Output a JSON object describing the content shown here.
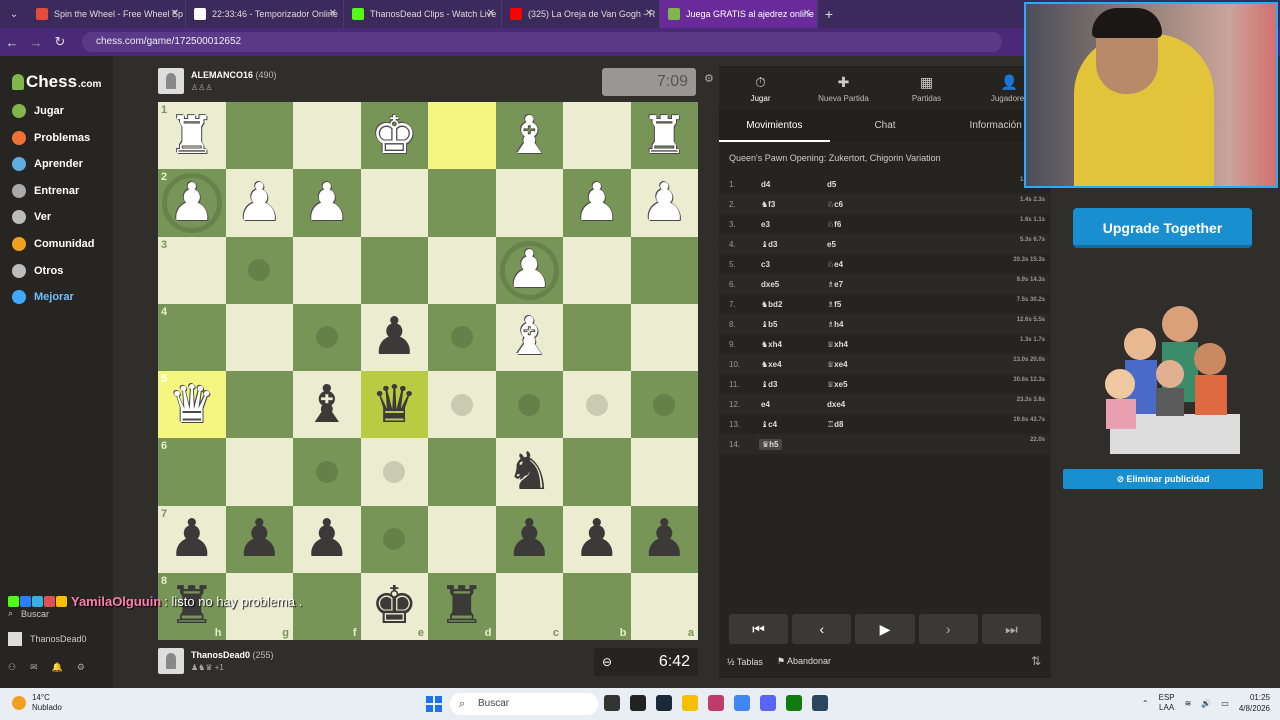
{
  "browser": {
    "tabs": [
      {
        "title": "Spin the Wheel - Free Wheel Sp",
        "color": "#e64a3b",
        "active": false
      },
      {
        "title": "22:33:46 - Temporizador Online",
        "color": "#ffffff",
        "active": false
      },
      {
        "title": "ThanosDead Clips - Watch Live",
        "color": "#53fc18",
        "active": false
      },
      {
        "title": "(325) La Oreja de Van Gogh - R",
        "color": "#ff0000",
        "active": false
      },
      {
        "title": "Juega GRATIS al ajedrez online",
        "color": "#81b64c",
        "active": true
      }
    ],
    "url": "chess.com/game/172500012652"
  },
  "sidebar": {
    "logo": "Chess",
    "logo_suffix": ".com",
    "items": [
      {
        "label": "Jugar",
        "color": "#81b64c"
      },
      {
        "label": "Problemas",
        "color": "#f27036"
      },
      {
        "label": "Aprender",
        "color": "#5dade2"
      },
      {
        "label": "Entrenar",
        "color": "#aaaaaa"
      },
      {
        "label": "Ver",
        "color": "#bbbbbb"
      },
      {
        "label": "Comunidad",
        "color": "#f0a020"
      },
      {
        "label": "Otros",
        "color": "#bbbbbb"
      },
      {
        "label": "Mejorar",
        "color": "#3fa9ff"
      }
    ],
    "search_label": "Buscar",
    "username": "ThanosDead0",
    "notification_count": "1"
  },
  "top_player": {
    "name": "ALEMANCO16",
    "rating": "(490)",
    "clock": "7:09"
  },
  "bottom_player": {
    "name": "ThanosDead0",
    "rating": "(255)",
    "clock": "6:42",
    "extra": "+1"
  },
  "board": {
    "ranks": [
      "1",
      "2",
      "3",
      "4",
      "5",
      "6",
      "7",
      "8"
    ],
    "files": [
      "h",
      "g",
      "f",
      "e",
      "d",
      "c",
      "b",
      "a"
    ],
    "squares": [
      [
        "♜",
        "",
        "",
        "♚",
        "",
        "♝",
        "",
        "♜"
      ],
      [
        "♟",
        "♟",
        "♟",
        "",
        "",
        "",
        "♟",
        "♟"
      ],
      [
        "",
        "",
        "",
        "",
        "",
        "♟",
        "",
        ""
      ],
      [
        "",
        "",
        "",
        "♟",
        "",
        "♝",
        "",
        ""
      ],
      [
        "♛",
        "",
        "♝",
        "♛",
        "",
        "",
        "",
        ""
      ],
      [
        "",
        "",
        "",
        "",
        "",
        "♞",
        "",
        ""
      ],
      [
        "♟",
        "♟",
        "♟",
        "",
        "",
        "♟",
        "♟",
        "♟"
      ],
      [
        "♜",
        "",
        "",
        "♚",
        "♜",
        "",
        "",
        ""
      ]
    ],
    "piece_colors": [
      [
        "w",
        "",
        "",
        "w",
        "",
        "w",
        "",
        "w"
      ],
      [
        "w",
        "w",
        "w",
        "",
        "",
        "",
        "w",
        "w"
      ],
      [
        "",
        "",
        "",
        "",
        "",
        "w",
        "",
        ""
      ],
      [
        "",
        "",
        "",
        "b",
        "",
        "w",
        "",
        ""
      ],
      [
        "w",
        "",
        "b",
        "b",
        "",
        "",
        "",
        ""
      ],
      [
        "",
        "",
        "",
        "",
        "",
        "b",
        "",
        ""
      ],
      [
        "b",
        "b",
        "b",
        "",
        "",
        "b",
        "b",
        "b"
      ],
      [
        "b",
        "",
        "",
        "b",
        "b",
        "",
        "",
        ""
      ]
    ],
    "highlights": [
      "0-4",
      "4-0",
      "4-3"
    ],
    "dots": [
      "2-1",
      "3-2",
      "3-4",
      "4-4",
      "4-5",
      "4-6",
      "4-7",
      "5-2",
      "5-3",
      "6-3"
    ],
    "rings": [
      "1-0",
      "2-5"
    ]
  },
  "chat_overlay": {
    "user": "YamilaOlguuin",
    "message": ": listo no hay problema ."
  },
  "panel": {
    "tabs": [
      {
        "label": "Jugar",
        "icon": "⏱"
      },
      {
        "label": "Nueva Partida",
        "icon": "✚"
      },
      {
        "label": "Partidas",
        "icon": "▦"
      },
      {
        "label": "Jugadores",
        "icon": "👤"
      }
    ],
    "subtabs": [
      "Movimientos",
      "Chat",
      "Información"
    ],
    "opening": "Queen's Pawn Opening: Zukertort, Chigorin Variation",
    "moves": [
      {
        "n": "1.",
        "w": "d4",
        "b": "d5",
        "t": "1.3s 1.3s"
      },
      {
        "n": "2.",
        "w": "♞f3",
        "b": "♘c6",
        "t": "1.4s 2.3s"
      },
      {
        "n": "3.",
        "w": "e3",
        "b": "♘f6",
        "t": "1.6s 1.1s"
      },
      {
        "n": "4.",
        "w": "♝d3",
        "b": "e5",
        "t": "5.3s 6.7s"
      },
      {
        "n": "5.",
        "w": "c3",
        "b": "♘e4",
        "t": "20.3s 15.3s"
      },
      {
        "n": "6.",
        "w": "dxe5",
        "b": "♗e7",
        "t": "9.9s 14.3s"
      },
      {
        "n": "7.",
        "w": "♞bd2",
        "b": "♗f5",
        "t": "7.5s 30.2s"
      },
      {
        "n": "8.",
        "w": "♝b5",
        "b": "♗h4",
        "t": "12.6s 5.5s"
      },
      {
        "n": "9.",
        "w": "♞xh4",
        "b": "♕xh4",
        "t": "1.3s 1.7s"
      },
      {
        "n": "10.",
        "w": "♞xe4",
        "b": "♕xe4",
        "t": "13.0s 20.0s"
      },
      {
        "n": "11.",
        "w": "♝d3",
        "b": "♕xe5",
        "t": "30.6s 12.3s"
      },
      {
        "n": "12.",
        "w": "e4",
        "b": "dxe4",
        "t": "23.3s 3.8s"
      },
      {
        "n": "13.",
        "w": "♝c4",
        "b": "♖d8",
        "t": "19.6s 43.7s"
      },
      {
        "n": "14.",
        "w": "♛h5",
        "b": "",
        "t": "22.0s"
      }
    ],
    "controls": [
      "⏮",
      "‹",
      "▶",
      "›",
      "⏭"
    ],
    "footer": {
      "tables": "Tablas",
      "resign": "Abandonar"
    }
  },
  "ad": {
    "upgrade": "Upgrade Together",
    "remove": "Eliminar publicidad"
  },
  "taskbar": {
    "temp": "14°C",
    "weather": "Nublado",
    "search": "Buscar",
    "lang": "ESP",
    "lang2": "LAA",
    "time": "01:25",
    "date": "4/8/2026"
  }
}
